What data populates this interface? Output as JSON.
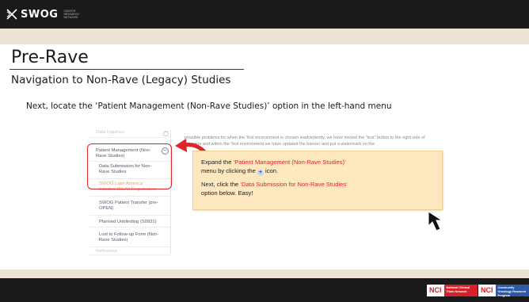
{
  "header": {
    "logo_text": "SWOG",
    "logo_subtext": "CANCER RESEARCH NETWORK"
  },
  "slide": {
    "title": "Pre-Rave",
    "subtitle": "Navigation to Non-Rave (Legacy) Studies",
    "body": "Next, locate the ‘Patient Management (Non-Rave Studies)’ option in the left-hand menu"
  },
  "menu": {
    "items": [
      {
        "label": "Data Inquiries"
      },
      {
        "label": "Patient Management (Non-Rave Studies)"
      },
      {
        "label": "Data Submission for Non-Rave Studies"
      },
      {
        "label": "SWOG Latin America Initiative (SLAI) Registration"
      },
      {
        "label": "SWOG Patient Transfer (pre-OPEN)"
      },
      {
        "label": "Planned Unblinding (S0931)"
      },
      {
        "label": "Lost to Follow-up Form (Non-Rave Studies)"
      },
      {
        "label": "Reference"
      }
    ],
    "background_text": "possible problems for when the Test environment is chosen inadvertently, we have moved the \"test\" button to the right side of the page and within the Test environment we have updated the banner and put a watermark on the"
  },
  "callout": {
    "line1_pre": "Expand the ",
    "line1_highlight": "‘Patient Management (Non-Rave Studies)’",
    "line2_pre": "menu by clicking the ",
    "line2_post": " icon.",
    "line3_pre": "Next, click the ",
    "line3_highlight": "‘Data Submission for Non-Rave Studies’",
    "line4": "option below. Easy!"
  },
  "footer": {
    "nci1_abbr": "NCI",
    "nci1_text": "National Clinical Trials Network",
    "nci2_abbr": "NCI",
    "nci2_text": "Community Oncology Research Program"
  },
  "colors": {
    "header_bg": "#1a1a1a",
    "band_tan": "#ece4d2",
    "highlight_red": "#e0242a",
    "callout_bg": "#fde8bf",
    "nci_red": "#d6202a",
    "nci_blue": "#2d5aa6"
  },
  "icons": {
    "logo": "swog-x-icon",
    "plus": "plus-circle-icon",
    "curved_arrow": "curved-arrow-icon",
    "cursor": "mouse-cursor-icon"
  }
}
